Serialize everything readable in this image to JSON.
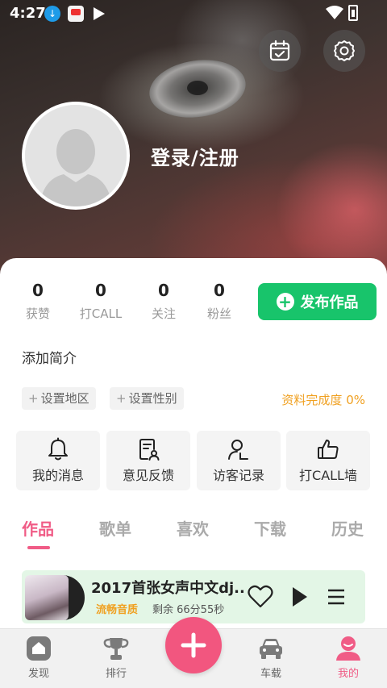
{
  "status_bar": {
    "time": "4:27"
  },
  "profile": {
    "login_label": "登录/注册"
  },
  "stats": [
    {
      "value": "0",
      "label": "获赞"
    },
    {
      "value": "0",
      "label": "打CALL"
    },
    {
      "value": "0",
      "label": "关注"
    },
    {
      "value": "0",
      "label": "粉丝"
    }
  ],
  "publish_button": {
    "label": "发布作品"
  },
  "intro": {
    "label": "添加简介"
  },
  "tags": [
    {
      "label": "设置地区"
    },
    {
      "label": "设置性别"
    }
  ],
  "completion": {
    "text": "资料完成度 0%"
  },
  "quick_actions": [
    {
      "label": "我的消息",
      "icon": "bell-icon"
    },
    {
      "label": "意见反馈",
      "icon": "feedback-icon"
    },
    {
      "label": "访客记录",
      "icon": "visitor-icon"
    },
    {
      "label": "打CALL墙",
      "icon": "thumbs-up-icon"
    }
  ],
  "tabs": [
    {
      "label": "作品",
      "active": true
    },
    {
      "label": "歌单",
      "active": false
    },
    {
      "label": "喜欢",
      "active": false
    },
    {
      "label": "下载",
      "active": false
    },
    {
      "label": "历史",
      "active": false
    }
  ],
  "player": {
    "title": "2017首张女声中文dj..",
    "quality": "流畅音质",
    "remaining": "剩余 66分55秒"
  },
  "bottom_nav": [
    {
      "label": "发现",
      "icon": "home-icon",
      "active": false
    },
    {
      "label": "排行",
      "icon": "trophy-icon",
      "active": false
    },
    {
      "label": "车载",
      "icon": "car-icon",
      "active": false
    },
    {
      "label": "我的",
      "icon": "user-icon",
      "active": true
    }
  ],
  "colors": {
    "accent_pink": "#f05c86",
    "publish_green": "#18c46b",
    "completion_orange": "#f0a020"
  }
}
